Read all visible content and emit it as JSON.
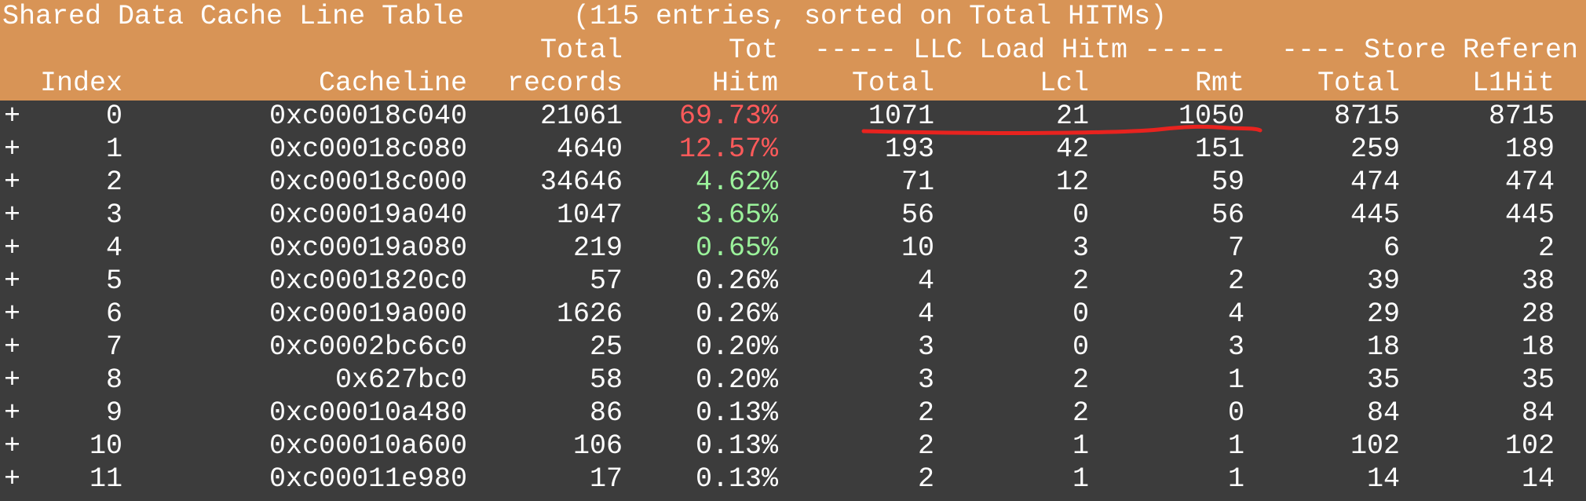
{
  "title_line": {
    "title": "Shared Data Cache Line Table",
    "summary": "(115 entries, sorted on Total HITMs)"
  },
  "header_line2": {
    "total": "Total",
    "tot": "Tot",
    "llc_group": "----- LLC Load Hitm -----",
    "store_group": "---- Store Referen"
  },
  "header_line3": {
    "index": "Index",
    "cacheline": "Cacheline",
    "records": "records",
    "hitm": "Hitm",
    "llc_total": "Total",
    "lcl": "Lcl",
    "rmt": "Rmt",
    "store_total": "Total",
    "l1hit": "L1Hit"
  },
  "rows": [
    {
      "expander": "+",
      "index": "0",
      "cacheline": "0xc00018c040",
      "records": "21061",
      "hitm": "69.73%",
      "hitm_color": "red",
      "llc_total": "1071",
      "lcl": "21",
      "rmt": "1050",
      "store_total": "8715",
      "l1hit": "8715"
    },
    {
      "expander": "+",
      "index": "1",
      "cacheline": "0xc00018c080",
      "records": "4640",
      "hitm": "12.57%",
      "hitm_color": "red",
      "llc_total": "193",
      "lcl": "42",
      "rmt": "151",
      "store_total": "259",
      "l1hit": "189"
    },
    {
      "expander": "+",
      "index": "2",
      "cacheline": "0xc00018c000",
      "records": "34646",
      "hitm": "4.62%",
      "hitm_color": "green",
      "llc_total": "71",
      "lcl": "12",
      "rmt": "59",
      "store_total": "474",
      "l1hit": "474"
    },
    {
      "expander": "+",
      "index": "3",
      "cacheline": "0xc00019a040",
      "records": "1047",
      "hitm": "3.65%",
      "hitm_color": "green",
      "llc_total": "56",
      "lcl": "0",
      "rmt": "56",
      "store_total": "445",
      "l1hit": "445"
    },
    {
      "expander": "+",
      "index": "4",
      "cacheline": "0xc00019a080",
      "records": "219",
      "hitm": "0.65%",
      "hitm_color": "green",
      "llc_total": "10",
      "lcl": "3",
      "rmt": "7",
      "store_total": "6",
      "l1hit": "2"
    },
    {
      "expander": "+",
      "index": "5",
      "cacheline": "0xc0001820c0",
      "records": "57",
      "hitm": "0.26%",
      "hitm_color": "white",
      "llc_total": "4",
      "lcl": "2",
      "rmt": "2",
      "store_total": "39",
      "l1hit": "38"
    },
    {
      "expander": "+",
      "index": "6",
      "cacheline": "0xc00019a000",
      "records": "1626",
      "hitm": "0.26%",
      "hitm_color": "white",
      "llc_total": "4",
      "lcl": "0",
      "rmt": "4",
      "store_total": "29",
      "l1hit": "28"
    },
    {
      "expander": "+",
      "index": "7",
      "cacheline": "0xc0002bc6c0",
      "records": "25",
      "hitm": "0.20%",
      "hitm_color": "white",
      "llc_total": "3",
      "lcl": "0",
      "rmt": "3",
      "store_total": "18",
      "l1hit": "18"
    },
    {
      "expander": "+",
      "index": "8",
      "cacheline": "0x627bc0",
      "records": "58",
      "hitm": "0.20%",
      "hitm_color": "white",
      "llc_total": "3",
      "lcl": "2",
      "rmt": "1",
      "store_total": "35",
      "l1hit": "35"
    },
    {
      "expander": "+",
      "index": "9",
      "cacheline": "0xc00010a480",
      "records": "86",
      "hitm": "0.13%",
      "hitm_color": "white",
      "llc_total": "2",
      "lcl": "2",
      "rmt": "0",
      "store_total": "84",
      "l1hit": "84"
    },
    {
      "expander": "+",
      "index": "10",
      "cacheline": "0xc00010a600",
      "records": "106",
      "hitm": "0.13%",
      "hitm_color": "white",
      "llc_total": "2",
      "lcl": "1",
      "rmt": "1",
      "store_total": "102",
      "l1hit": "102"
    },
    {
      "expander": "+",
      "index": "11",
      "cacheline": "0xc00011e980",
      "records": "17",
      "hitm": "0.13%",
      "hitm_color": "white",
      "llc_total": "2",
      "lcl": "1",
      "rmt": "1",
      "store_total": "14",
      "l1hit": "14"
    }
  ],
  "colors": {
    "header_bg": "#d89456",
    "terminal_bg": "#3c3c3c",
    "text": "#ffffff",
    "hitm_red": "#ff5a5a",
    "hitm_green": "#9bf29b",
    "annotation_red": "#e8231f"
  }
}
